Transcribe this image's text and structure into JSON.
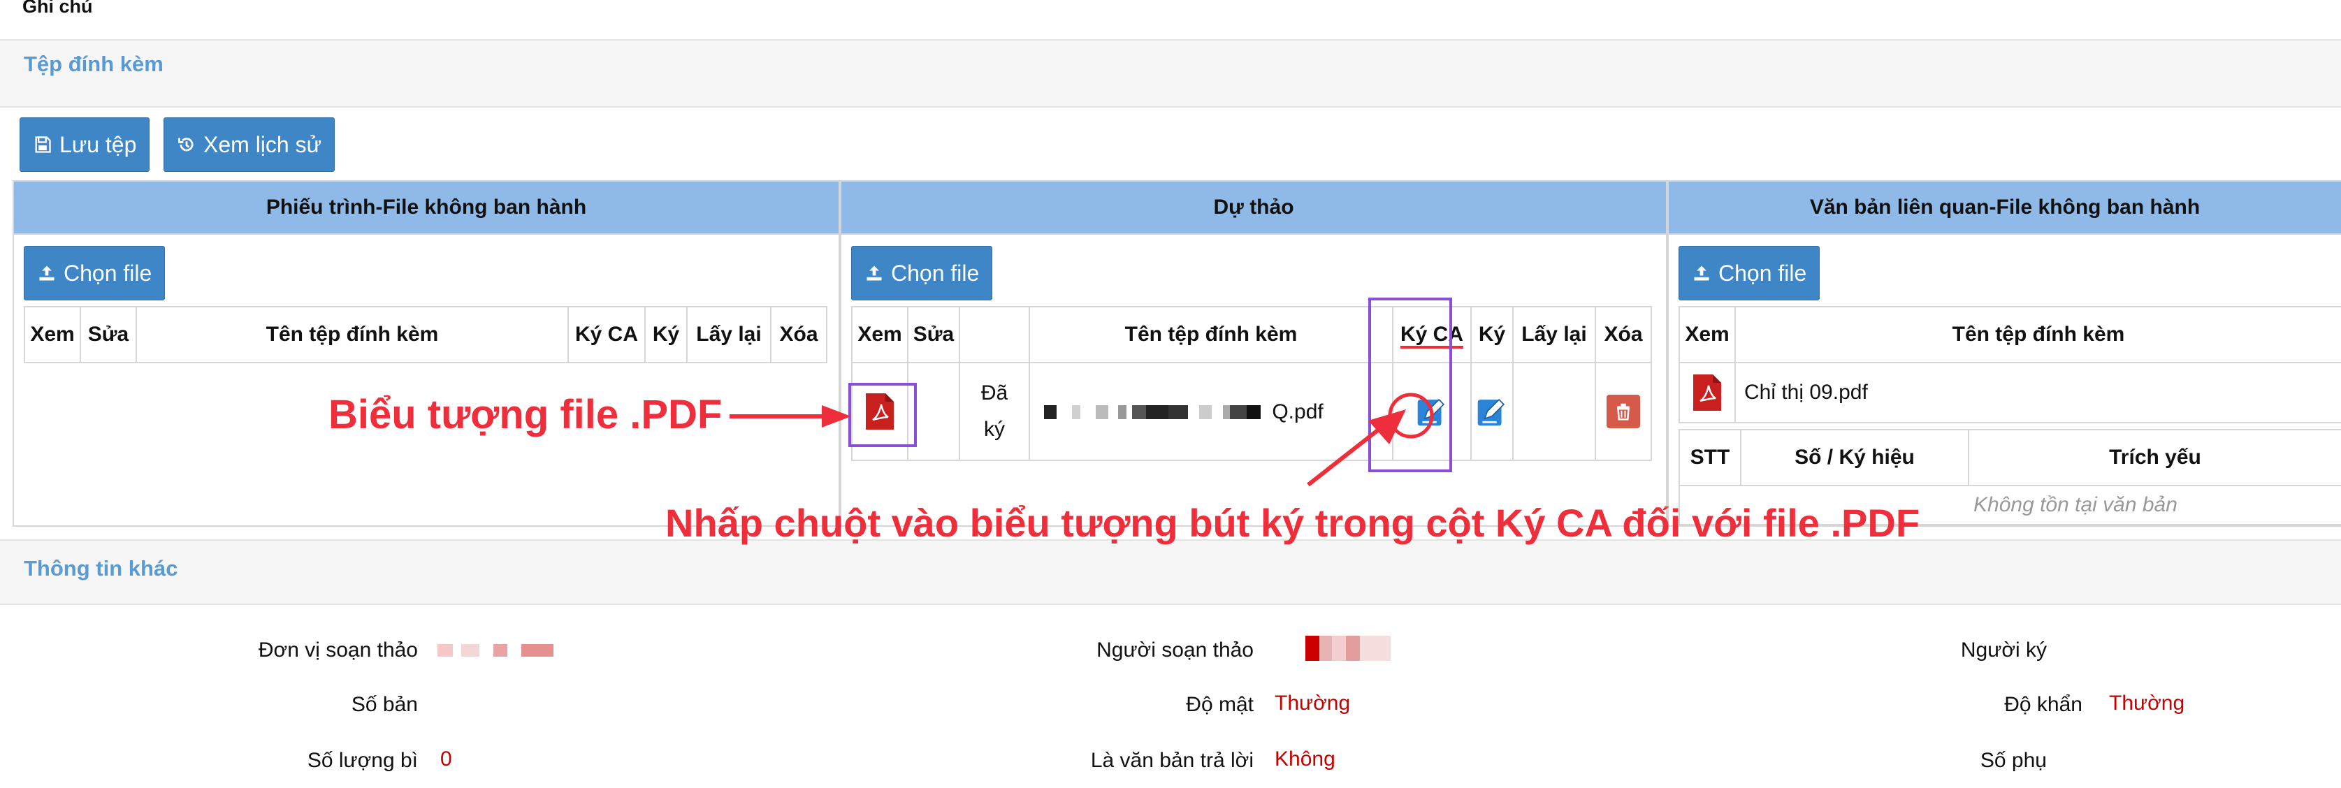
{
  "top_label": "Ghi chú",
  "attachments": {
    "section_title": "Tệp đính kèm",
    "save_button": "Lưu tệp",
    "history_button": "Xem lịch sử"
  },
  "panels": {
    "left": {
      "title": "Phiếu trình-File không ban hành",
      "choose_button": "Chọn file",
      "columns": [
        "Xem",
        "Sửa",
        "Tên tệp đính kèm",
        "Ký CA",
        "Ký",
        "Lấy lại",
        "Xóa"
      ]
    },
    "middle": {
      "title": "Dự thảo",
      "choose_button": "Chọn file",
      "columns": [
        "Xem",
        "Sửa",
        "",
        "Tên tệp đính kèm",
        "Ký CA",
        "Ký",
        "Lấy lại",
        "Xóa"
      ],
      "row": {
        "status_line1": "Đã",
        "status_line2": "ký",
        "filename_suffix": "Q.pdf"
      }
    },
    "right": {
      "title": "Văn bản liên quan-File không ban hành",
      "choose_button": "Chọn file",
      "columns": [
        "Xem",
        "Tên tệp đính kèm"
      ],
      "file_name": "Chỉ thị 09.pdf",
      "doc_columns": [
        "STT",
        "Số / Ký hiệu",
        "Trích yếu"
      ],
      "empty_text": "Không tồn tại văn bản"
    }
  },
  "other_info": {
    "section_title": "Thông tin khác",
    "fields": {
      "don_vi_label": "Đơn vị soạn thảo",
      "nguoi_soan_label": "Người soạn thảo",
      "nguoi_ky_label": "Người ký",
      "so_ban_label": "Số bản",
      "do_mat_label": "Độ mật",
      "do_mat_value": "Thường",
      "do_khan_label": "Độ khẩn",
      "do_khan_value": "Thường",
      "so_luong_bi_label": "Số lượng bì",
      "so_luong_bi_value": "0",
      "la_van_ban_label": "Là văn bản trả lời",
      "la_van_ban_value": "Không",
      "so_phu_label": "Số phụ"
    }
  },
  "annotations": {
    "pdf_icon_note": "Biểu tượng file .PDF",
    "sign_note": "Nhấp chuột vào biểu tượng bút ký trong cột Ký CA đối với file .PDF",
    "annotation_color": "#ee2e3b",
    "highlight_color": "#8a4fd6"
  },
  "colors": {
    "button_blue": "#3f86c6",
    "header_blue": "#8fb9e6",
    "section_title_blue": "#5a9ad2",
    "value_red": "#c40000"
  }
}
